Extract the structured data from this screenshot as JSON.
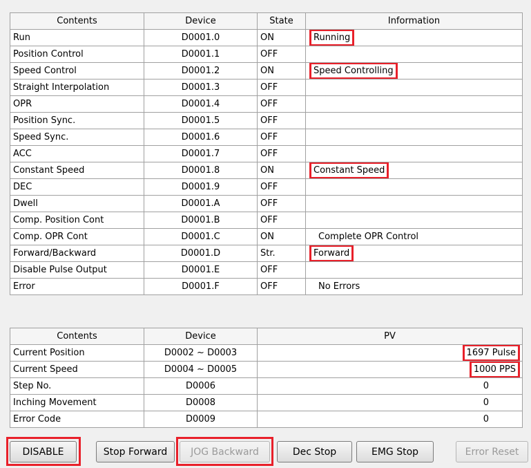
{
  "status_table": {
    "headers": [
      "Contents",
      "Device",
      "State",
      "Information"
    ],
    "rows": [
      {
        "contents": "Run",
        "device": "D0001.0",
        "state": "ON",
        "info": "Running",
        "highlight": true
      },
      {
        "contents": "Position Control",
        "device": "D0001.1",
        "state": "OFF",
        "info": "",
        "highlight": false
      },
      {
        "contents": "Speed Control",
        "device": "D0001.2",
        "state": "ON",
        "info": "Speed Controlling",
        "highlight": true
      },
      {
        "contents": "Straight Interpolation",
        "device": "D0001.3",
        "state": "OFF",
        "info": "",
        "highlight": false
      },
      {
        "contents": "OPR",
        "device": "D0001.4",
        "state": "OFF",
        "info": "",
        "highlight": false
      },
      {
        "contents": "Position Sync.",
        "device": "D0001.5",
        "state": "OFF",
        "info": "",
        "highlight": false
      },
      {
        "contents": "Speed Sync.",
        "device": "D0001.6",
        "state": "OFF",
        "info": "",
        "highlight": false
      },
      {
        "contents": "ACC",
        "device": "D0001.7",
        "state": "OFF",
        "info": "",
        "highlight": false
      },
      {
        "contents": "Constant Speed",
        "device": "D0001.8",
        "state": "ON",
        "info": "Constant Speed",
        "highlight": true
      },
      {
        "contents": "DEC",
        "device": "D0001.9",
        "state": "OFF",
        "info": "",
        "highlight": false
      },
      {
        "contents": "Dwell",
        "device": "D0001.A",
        "state": "OFF",
        "info": "",
        "highlight": false
      },
      {
        "contents": "Comp. Position Cont",
        "device": "D0001.B",
        "state": "OFF",
        "info": "",
        "highlight": false
      },
      {
        "contents": "Comp. OPR Cont",
        "device": "D0001.C",
        "state": "ON",
        "info": "Complete OPR Control",
        "highlight": false
      },
      {
        "contents": "Forward/Backward",
        "device": "D0001.D",
        "state": "Str.",
        "info": "Forward",
        "highlight": true
      },
      {
        "contents": "Disable Pulse Output",
        "device": "D0001.E",
        "state": "OFF",
        "info": "",
        "highlight": false
      },
      {
        "contents": "Error",
        "device": "D0001.F",
        "state": "OFF",
        "info": "No Errors",
        "highlight": false
      }
    ]
  },
  "pv_table": {
    "headers": [
      "Contents",
      "Device",
      "PV"
    ],
    "rows": [
      {
        "contents": "Current Position",
        "device": "D0002 ~ D0003",
        "pv": "1697 Pulse",
        "highlight": true
      },
      {
        "contents": "Current Speed",
        "device": "D0004 ~ D0005",
        "pv": "1000 PPS",
        "highlight": true
      },
      {
        "contents": "Step No.",
        "device": "D0006",
        "pv": "0",
        "highlight": false
      },
      {
        "contents": "Inching Movement",
        "device": "D0008",
        "pv": "0",
        "highlight": false
      },
      {
        "contents": "Error Code",
        "device": "D0009",
        "pv": "0",
        "highlight": false
      }
    ]
  },
  "buttons": {
    "disable": "DISABLE",
    "stop_forward": "Stop Forward",
    "jog_backward": "JOG Backward",
    "dec_stop": "Dec Stop",
    "emg_stop": "EMG Stop",
    "error_reset": "Error Reset"
  },
  "colors": {
    "highlight": "#e8202a",
    "grid": "#a0a0a0",
    "background": "#f0f0f0"
  }
}
